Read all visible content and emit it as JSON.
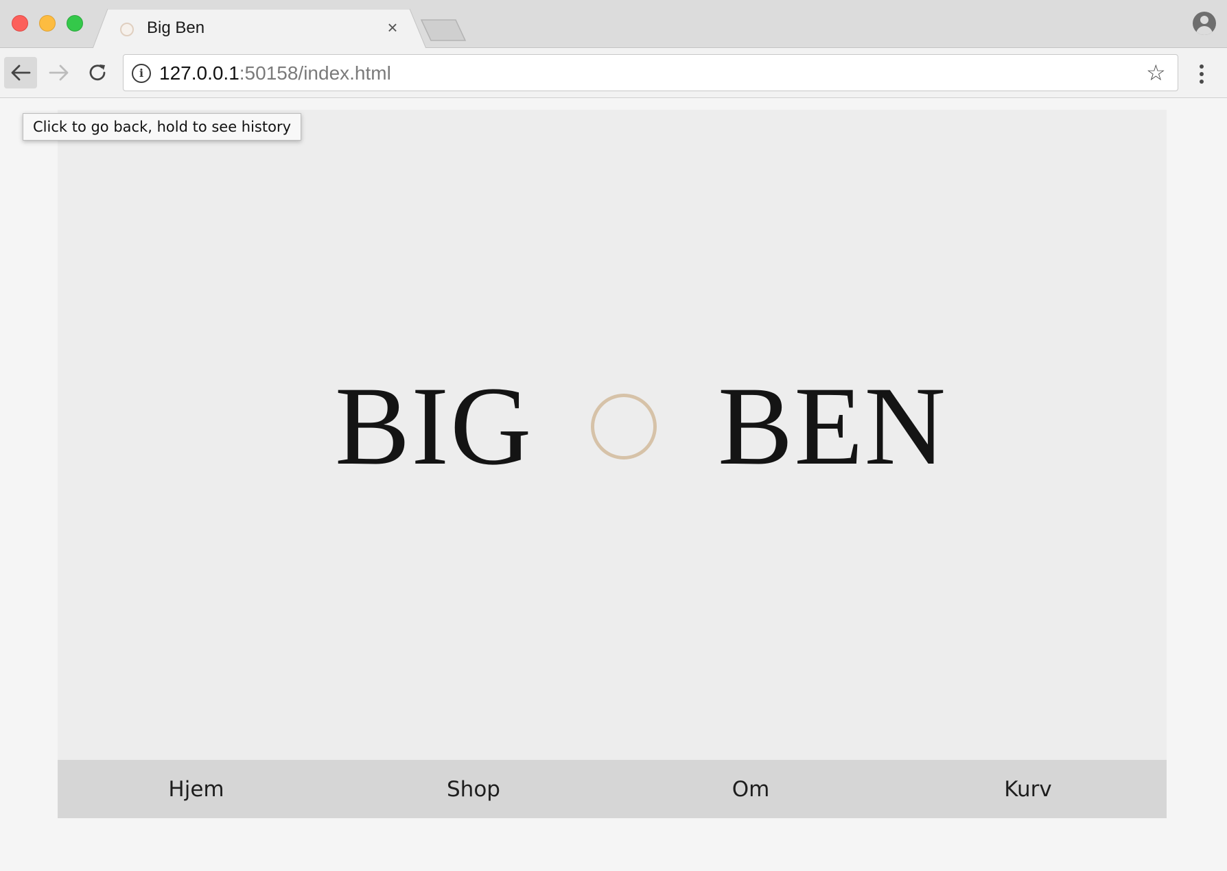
{
  "browser": {
    "tab": {
      "title": "Big Ben",
      "close_glyph": "×",
      "favicon": "circle-favicon-icon"
    },
    "address_bar": {
      "host": "127.0.0.1",
      "rest": ":50158/index.html"
    },
    "icons": {
      "back": "arrow-left-icon",
      "forward": "arrow-right-icon",
      "reload": "reload-icon",
      "info": "info-icon",
      "star": "star-icon",
      "menu": "kebab-menu-icon",
      "profile": "profile-icon"
    },
    "tooltip": "Click to go back, hold to see history"
  },
  "page": {
    "logo": {
      "left_word": "BIG",
      "right_word": "BEN",
      "ring_color": "#d6c2a8"
    },
    "nav": [
      {
        "label": "Hjem"
      },
      {
        "label": "Shop"
      },
      {
        "label": "Om"
      },
      {
        "label": "Kurv"
      }
    ]
  },
  "colors": {
    "hero_bg": "#ededed",
    "nav_bg": "#d6d6d6",
    "page_bg": "#f5f5f5"
  }
}
